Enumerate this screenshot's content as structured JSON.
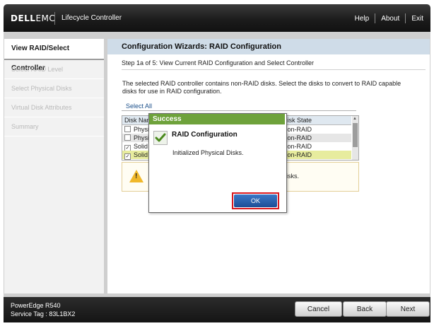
{
  "header": {
    "logo_brand": "DELL",
    "logo_suffix": "EMC",
    "app_title": "Lifecycle Controller",
    "links": [
      "Help",
      "About",
      "Exit"
    ]
  },
  "sidebar": {
    "items": [
      {
        "label": "View RAID/Select Controller",
        "active": true
      },
      {
        "label": "Select RAID Level",
        "active": false
      },
      {
        "label": "Select Physical Disks",
        "active": false
      },
      {
        "label": "Virtual Disk Attributes",
        "active": false
      },
      {
        "label": "Summary",
        "active": false
      }
    ]
  },
  "main": {
    "title": "Configuration Wizards: RAID Configuration",
    "step": "Step 1a of 5: View Current RAID Configuration and Select Controller",
    "description": "The selected RAID controller contains non-RAID disks. Select the disks to convert to RAID capable disks for use in RAID configuration.",
    "select_all": "Select All",
    "table": {
      "headers": [
        "Disk Nam",
        "Disk State"
      ],
      "rows": [
        {
          "name": "Physi",
          "state": "Non-RAID",
          "checked": false
        },
        {
          "name": "Physi",
          "state": "Non-RAID",
          "checked": false
        },
        {
          "name": "Solid",
          "state": "Non-RAID",
          "checked": true
        },
        {
          "name": "Solid",
          "state": "Non-RAID",
          "checked": true
        }
      ]
    },
    "warning_text": "disks."
  },
  "modal": {
    "title": "Success",
    "heading": "RAID Configuration",
    "message": "Initialized Physical Disks.",
    "ok_label": "OK"
  },
  "footer": {
    "model": "PowerEdge R540",
    "service_tag": "Service Tag : 83L1BX2",
    "buttons": {
      "cancel": "Cancel",
      "back": "Back",
      "next": "Next"
    }
  },
  "colors": {
    "header_bg": "#1c1c1c",
    "title_bar": "#cfdce8",
    "success_green": "#6ea23b",
    "ok_blue": "#2a62b0",
    "highlight_red": "#d9191f",
    "row_highlight": "#e7ec9e"
  }
}
